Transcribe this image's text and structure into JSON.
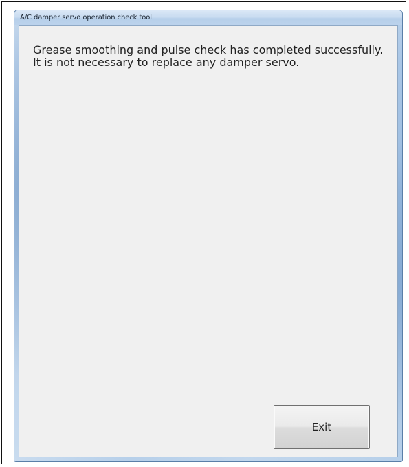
{
  "window": {
    "title": "A/C damper servo operation check tool"
  },
  "message": {
    "line1": "Grease smoothing and pulse check has completed successfully.",
    "line2": "It is not necessary to replace any damper servo."
  },
  "buttons": {
    "exit_label": "Exit"
  },
  "colors": {
    "window_frame": "#a9c6e6",
    "client_background": "#f0f0f0",
    "text": "#222222"
  }
}
